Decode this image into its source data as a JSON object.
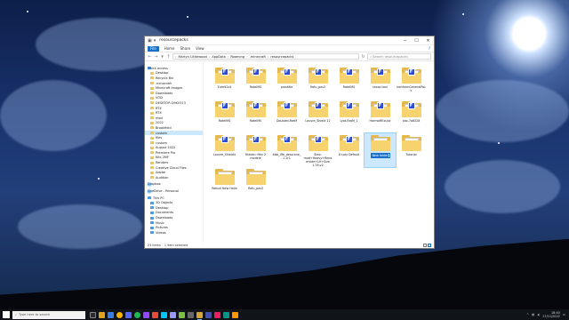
{
  "window": {
    "title": "resourcepacks",
    "ribbon_tabs": [
      "File",
      "Home",
      "Share",
      "View"
    ],
    "path": [
      "Martyn Littlewood",
      "AppData",
      "Roaming",
      ".minecraft",
      "resourcepacks"
    ],
    "search_placeholder": "Search resourcepacks"
  },
  "sidebar": {
    "items": [
      {
        "label": "Quick access",
        "icon": "star-icon",
        "type": "group"
      },
      {
        "label": "Desktop",
        "icon": "folder-icon"
      },
      {
        "label": "Recycle Bin",
        "icon": "folder-icon"
      },
      {
        "label": ".minecraft",
        "icon": "folder-icon"
      },
      {
        "label": "Minecraft Images",
        "icon": "folder-icon"
      },
      {
        "label": "Downloads",
        "icon": "folder-icon"
      },
      {
        "label": "VOD",
        "icon": "folder-icon"
      },
      {
        "label": "DESKTOP-Q9KV313",
        "icon": "folder-icon"
      },
      {
        "label": "RTX",
        "icon": "folder-icon"
      },
      {
        "label": "RTX",
        "icon": "folder-icon"
      },
      {
        "label": "mod",
        "icon": "folder-icon"
      },
      {
        "label": "2022",
        "icon": "folder-icon"
      },
      {
        "label": "Brookfield",
        "icon": "folder-icon"
      },
      {
        "label": "custom",
        "icon": "folder-icon",
        "selected": true
      },
      {
        "label": "files",
        "icon": "folder-icon"
      },
      {
        "label": "custom",
        "icon": "folder-icon"
      },
      {
        "label": "August 2022",
        "icon": "folder-icon"
      },
      {
        "label": "Premiere Pro",
        "icon": "folder-icon"
      },
      {
        "label": "Kits 2MF",
        "icon": "folder-icon"
      },
      {
        "label": "Renders",
        "icon": "folder-icon"
      },
      {
        "label": "Creative Cloud Files",
        "icon": "folder-icon"
      },
      {
        "label": "Adobe",
        "icon": "folder-icon"
      },
      {
        "label": "Audition",
        "icon": "folder-icon"
      },
      {
        "label": "Dropbox",
        "icon": "dropbox-icon",
        "type": "group"
      },
      {
        "label": "OneDrive - Personal",
        "icon": "onedrive-icon",
        "type": "group"
      },
      {
        "label": "This PC",
        "icon": "pc-icon",
        "type": "group"
      },
      {
        "label": "3D Objects",
        "icon": "pc-icon"
      },
      {
        "label": "Desktop",
        "icon": "pc-icon"
      },
      {
        "label": "Documents",
        "icon": "pc-icon"
      },
      {
        "label": "Downloads",
        "icon": "pc-icon"
      },
      {
        "label": "Music",
        "icon": "pc-icon"
      },
      {
        "label": "Pictures",
        "icon": "pc-icon"
      },
      {
        "label": "Videos",
        "icon": "pc-icon"
      }
    ]
  },
  "files": [
    {
      "label": "Eumlt2x4",
      "badge": true
    },
    {
      "label": "RatelMS",
      "badge": true
    },
    {
      "label": "prostitle",
      "badge": true
    },
    {
      "label": "flatu_pos3",
      "badge": true
    },
    {
      "label": "RatelMS",
      "badge": true
    },
    {
      "label": "texas tool",
      "badge": true
    },
    {
      "label": "northernGeneralPack",
      "badge": true
    },
    {
      "label": "RatelMS",
      "badge": true
    },
    {
      "label": "RatelMS",
      "badge": true
    },
    {
      "label": "Doubled-RatM",
      "badge": true
    },
    {
      "label": "Louvre_Shield 12",
      "badge": true
    },
    {
      "label": "Lyat-RatM_1",
      "badge": true
    },
    {
      "label": "HarmoMExulst",
      "badge": true
    },
    {
      "label": "xbx-7a6328",
      "badge": true
    },
    {
      "label": "Louvre_Shield4",
      "badge": true
    },
    {
      "label": "Hidden r9kv 2 modele",
      "badge": true
    },
    {
      "label": "ldsk_iffe_descrone_1 2r1",
      "badge": true
    },
    {
      "label": "Stair-mod+Heavy+Rend erside+LH+Size 1.78.v2",
      "badge": true
    },
    {
      "label": "8 suty Default",
      "badge": true
    },
    {
      "label": "",
      "badge": false,
      "selected": true,
      "rename": "New folder"
    },
    {
      "label": "Tutorial",
      "badge": false
    },
    {
      "label": "Reburl New Hailo",
      "badge": false
    },
    {
      "label": "flatu_pos3",
      "badge": false
    }
  ],
  "status": {
    "items": "23 items",
    "selected": "1 item selected"
  },
  "taskbar": {
    "search_placeholder": "Type here to search",
    "time": "18:40",
    "date": "17/11/2022"
  }
}
